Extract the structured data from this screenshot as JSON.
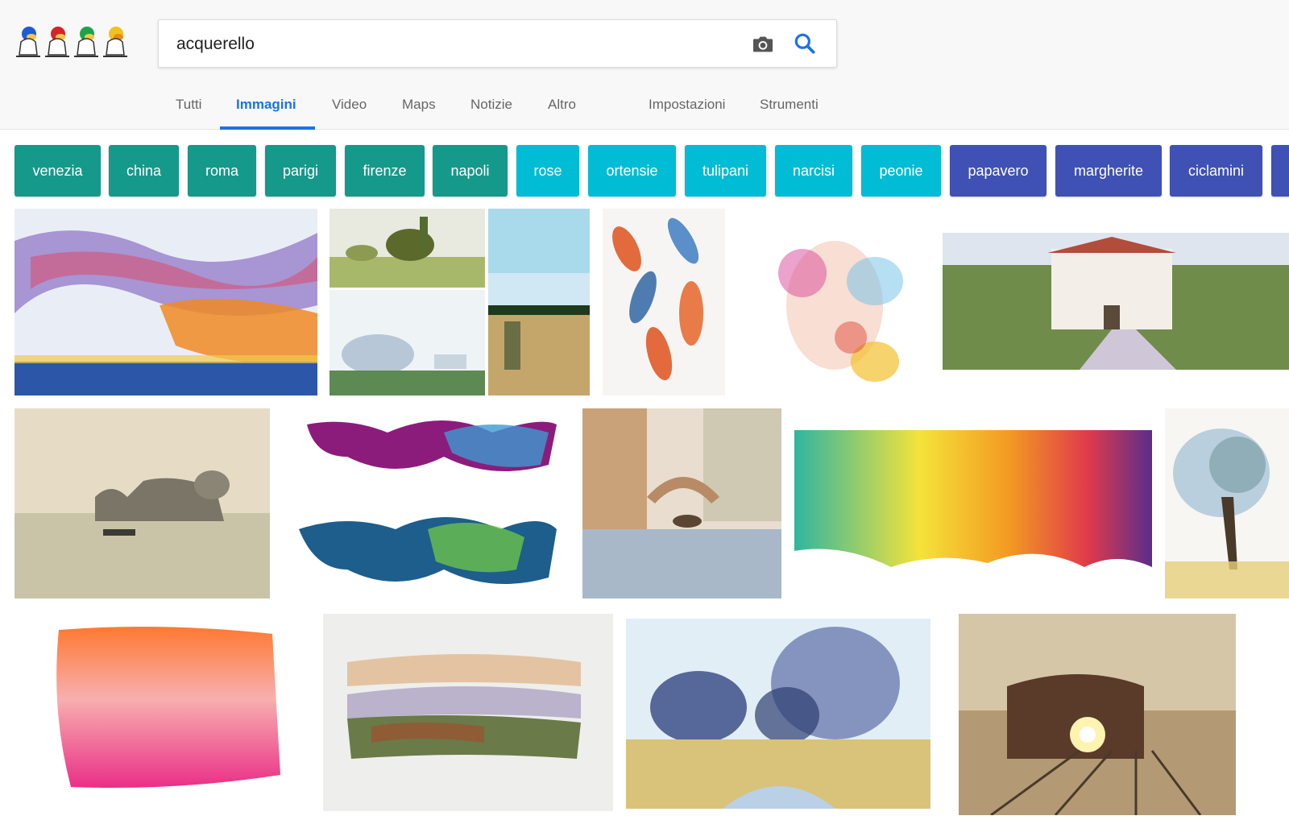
{
  "search": {
    "query": "acquerello"
  },
  "tabs": [
    {
      "label": "Tutti"
    },
    {
      "label": "Immagini",
      "active": true
    },
    {
      "label": "Video"
    },
    {
      "label": "Maps"
    },
    {
      "label": "Notizie"
    },
    {
      "label": "Altro"
    },
    {
      "label": "Impostazioni"
    },
    {
      "label": "Strumenti"
    }
  ],
  "chips": [
    {
      "label": "venezia"
    },
    {
      "label": "china"
    },
    {
      "label": "roma"
    },
    {
      "label": "parigi"
    },
    {
      "label": "firenze"
    },
    {
      "label": "napoli"
    },
    {
      "label": "rose"
    },
    {
      "label": "ortensie"
    },
    {
      "label": "tulipani"
    },
    {
      "label": "narcisi"
    },
    {
      "label": "peonie"
    },
    {
      "label": "papavero"
    },
    {
      "label": "margherite"
    },
    {
      "label": "ciclamini"
    }
  ],
  "colors": {
    "chip_teal": "#15998a",
    "chip_cyan": "#00bcd4",
    "chip_indigo": "#3f51b5",
    "accent_blue": "#1a73e8"
  },
  "icons": {
    "camera": "camera-icon",
    "search": "search-icon",
    "logo": "duck-logo"
  }
}
